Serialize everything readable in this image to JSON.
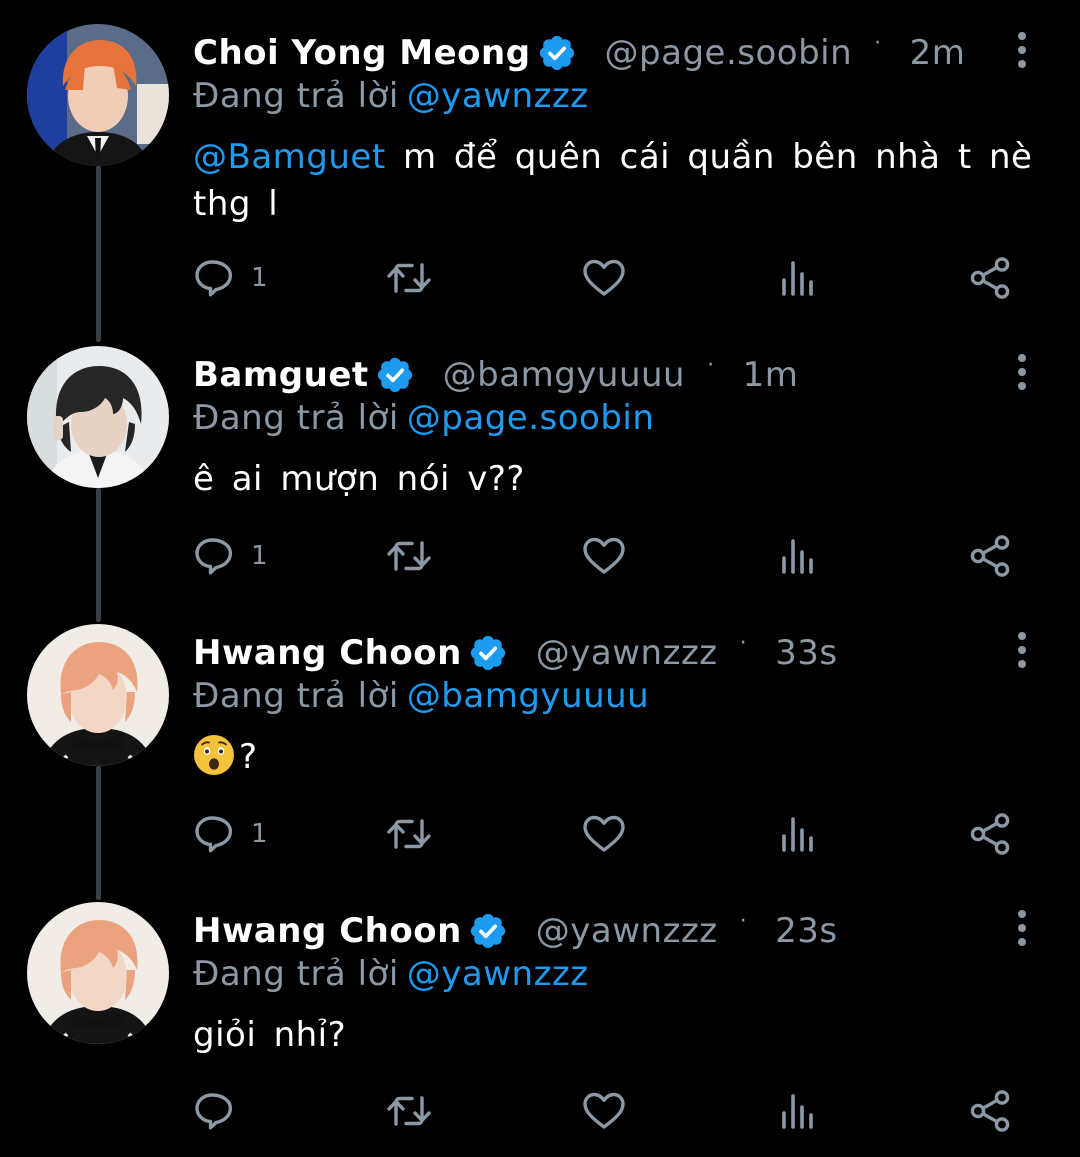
{
  "replying_prefix": "Đang trả lời",
  "colors": {
    "background": "#000000",
    "accent": "#1d9bf0",
    "secondary_text": "#8b98a5",
    "thread_line": "#3a3f44"
  },
  "tweets": [
    {
      "name": "Choi Yong Meong",
      "handle": "@page.soobin",
      "dot": "·",
      "time": "2m",
      "replying_to": "@yawnzzz",
      "mention": "@Bamguet",
      "text": " m để quên cái quần bên nhà t nè thg l",
      "reply_count": "1",
      "avatar_icon": "orange-hair-avatar"
    },
    {
      "name": "Bamguet",
      "handle": "@bamgyuuuu",
      "dot": "·",
      "time": "1m",
      "replying_to": "@page.soobin",
      "mention": "",
      "text": "ê ai mượn nói v??",
      "reply_count": "1",
      "avatar_icon": "dark-hair-avatar"
    },
    {
      "name": "Hwang Choon",
      "handle": "@yawnzzz",
      "dot": "·",
      "time": "33s",
      "replying_to": "@bamgyuuuu",
      "mention": "",
      "text": "?",
      "emoji": "astonished-face",
      "reply_count": "1",
      "avatar_icon": "peach-hair-avatar"
    },
    {
      "name": "Hwang Choon",
      "handle": "@yawnzzz",
      "dot": "·",
      "time": "23s",
      "replying_to": "@yawnzzz",
      "mention": "",
      "text": "giỏi nhỉ?",
      "reply_count": "",
      "avatar_icon": "peach-hair-avatar"
    }
  ]
}
